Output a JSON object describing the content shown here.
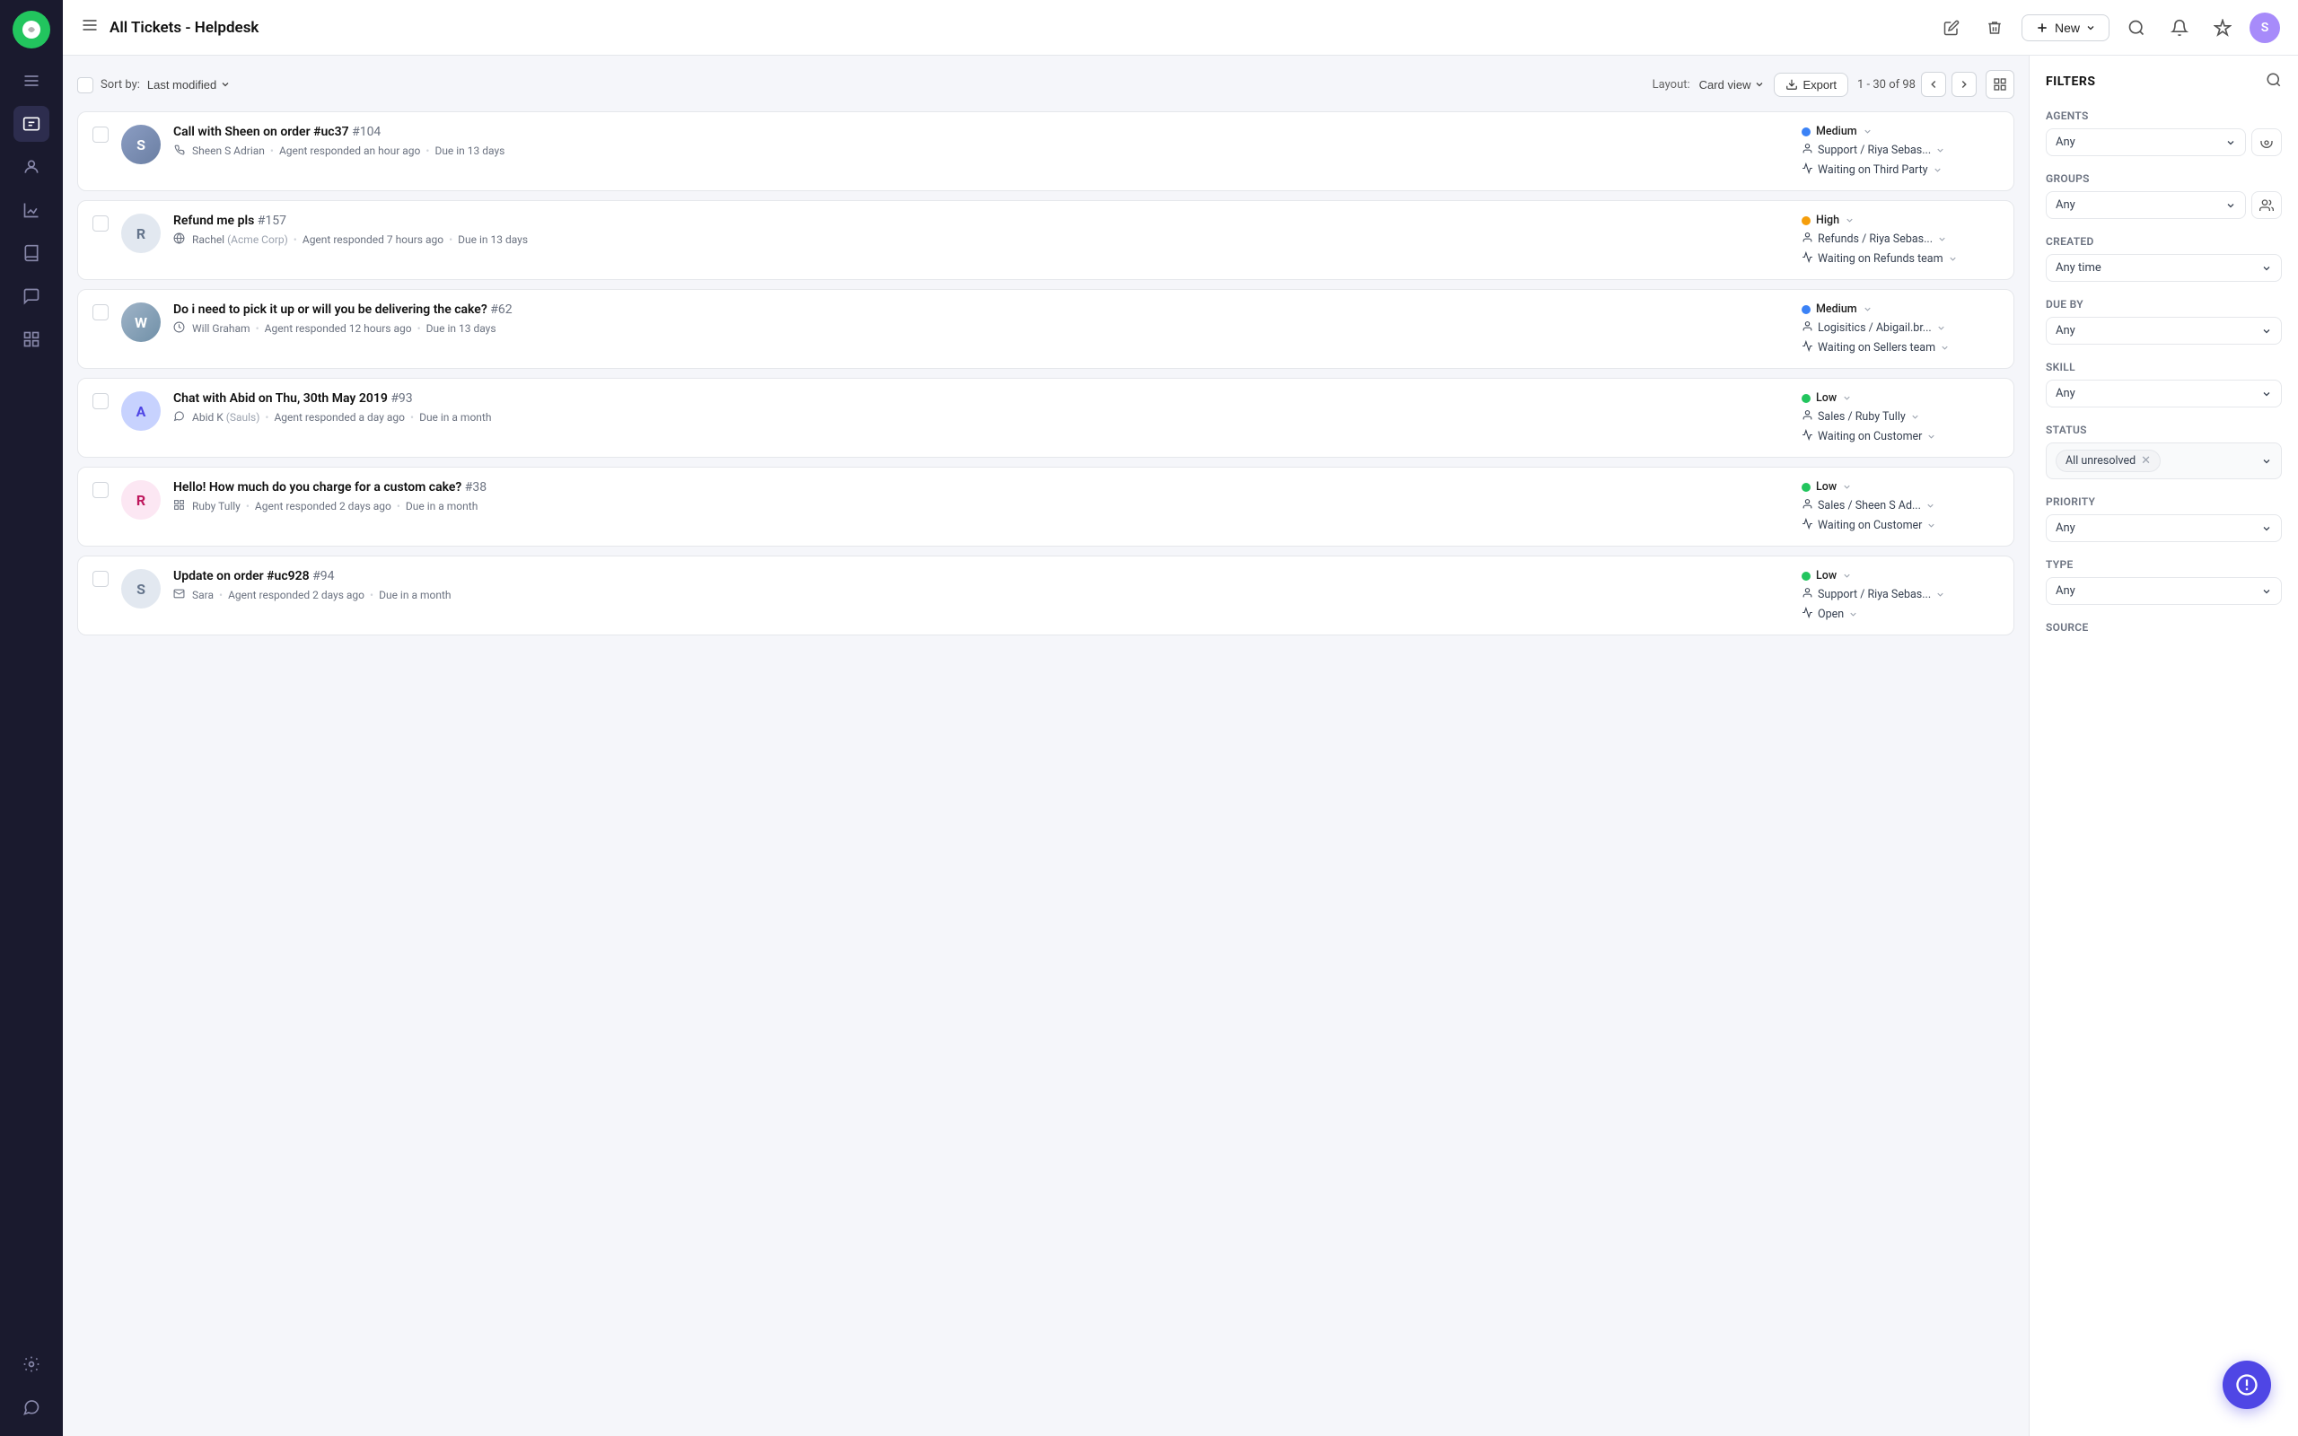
{
  "app": {
    "title": "All Tickets - Helpdesk",
    "new_button": "New",
    "user_initial": "S"
  },
  "toolbar": {
    "sort_label": "Sort by:",
    "sort_value": "Last modified",
    "layout_label": "Layout:",
    "layout_value": "Card view",
    "export_label": "Export",
    "pagination": "1 - 30 of 98"
  },
  "filters": {
    "title": "FILTERS",
    "agents_label": "Agents",
    "agents_placeholder": "Any",
    "groups_label": "Groups",
    "groups_placeholder": "Any",
    "created_label": "Created",
    "created_value": "Any time",
    "due_by_label": "Due by",
    "due_by_placeholder": "Any",
    "skill_label": "Skill",
    "skill_placeholder": "Any",
    "status_label": "Status",
    "status_value": "All unresolved",
    "priority_label": "Priority",
    "priority_placeholder": "Any",
    "type_label": "Type",
    "type_placeholder": "Any",
    "source_label": "Source"
  },
  "tickets": [
    {
      "id": 1,
      "title": "Call with Sheen on order #uc37",
      "ticket_id": "#104",
      "contact": "Sheen S Adrian",
      "contact_icon": "phone",
      "meta": "Agent responded an hour ago",
      "due": "Due in 13 days",
      "priority": "Medium",
      "priority_color": "blue",
      "team": "Support / Riya Sebas...",
      "status": "Waiting on Third Party",
      "avatar_type": "image",
      "avatar_color": "#b0c4de",
      "avatar_initial": "S"
    },
    {
      "id": 2,
      "title": "Refund me pls",
      "ticket_id": "#157",
      "contact": "Rachel",
      "contact_company": "Acme Corp",
      "contact_icon": "globe",
      "meta": "Agent responded 7 hours ago",
      "due": "Due in 13 days",
      "priority": "High",
      "priority_color": "orange",
      "team": "Refunds / Riya Sebas...",
      "status": "Waiting on Refunds team",
      "avatar_type": "initial",
      "avatar_color": "#e2e8f0",
      "avatar_initial": "R",
      "avatar_text_color": "#64748b"
    },
    {
      "id": 3,
      "title": "Do i need to pick it up or will you be delivering the cake?",
      "ticket_id": "#62",
      "contact": "Will Graham",
      "contact_icon": "clock",
      "meta": "Agent responded 12 hours ago",
      "due": "Due in 13 days",
      "priority": "Medium",
      "priority_color": "blue",
      "team": "Logisitics / Abigail.br...",
      "status": "Waiting on Sellers team",
      "avatar_type": "image",
      "avatar_color": "#b0c4de",
      "avatar_initial": "W"
    },
    {
      "id": 4,
      "title": "Chat with Abid on Thu, 30th May 2019",
      "ticket_id": "#93",
      "contact": "Abid K",
      "contact_company": "Sauls",
      "contact_icon": "chat",
      "meta": "Agent responded a day ago",
      "due": "Due in a month",
      "priority": "Low",
      "priority_color": "green",
      "team": "Sales / Ruby Tully",
      "status": "Waiting on Customer",
      "avatar_type": "initial",
      "avatar_color": "#c7d2fe",
      "avatar_initial": "A",
      "avatar_text_color": "#4f46e5"
    },
    {
      "id": 5,
      "title": "Hello! How much do you charge for a custom cake?",
      "ticket_id": "#38",
      "contact": "Ruby Tully",
      "contact_icon": "grid",
      "meta": "Agent responded 2 days ago",
      "due": "Due in a month",
      "priority": "Low",
      "priority_color": "green",
      "team": "Sales / Sheen S Ad...",
      "status": "Waiting on Customer",
      "avatar_type": "initial",
      "avatar_color": "#fce7f3",
      "avatar_initial": "R",
      "avatar_text_color": "#be185d"
    },
    {
      "id": 6,
      "title": "Update on order #uc928",
      "ticket_id": "#94",
      "contact": "Sara",
      "contact_icon": "email",
      "meta": "Agent responded 2 days ago",
      "due": "Due in a month",
      "priority": "Low",
      "priority_color": "green",
      "team": "Support / Riya Sebas...",
      "status": "Open",
      "avatar_type": "initial",
      "avatar_color": "#e2e8f0",
      "avatar_initial": "S",
      "avatar_text_color": "#64748b"
    }
  ],
  "sidebar_icons": [
    "menu",
    "helpdesk",
    "contacts",
    "analytics",
    "knowledge",
    "conversations",
    "reports",
    "settings",
    "chat"
  ]
}
